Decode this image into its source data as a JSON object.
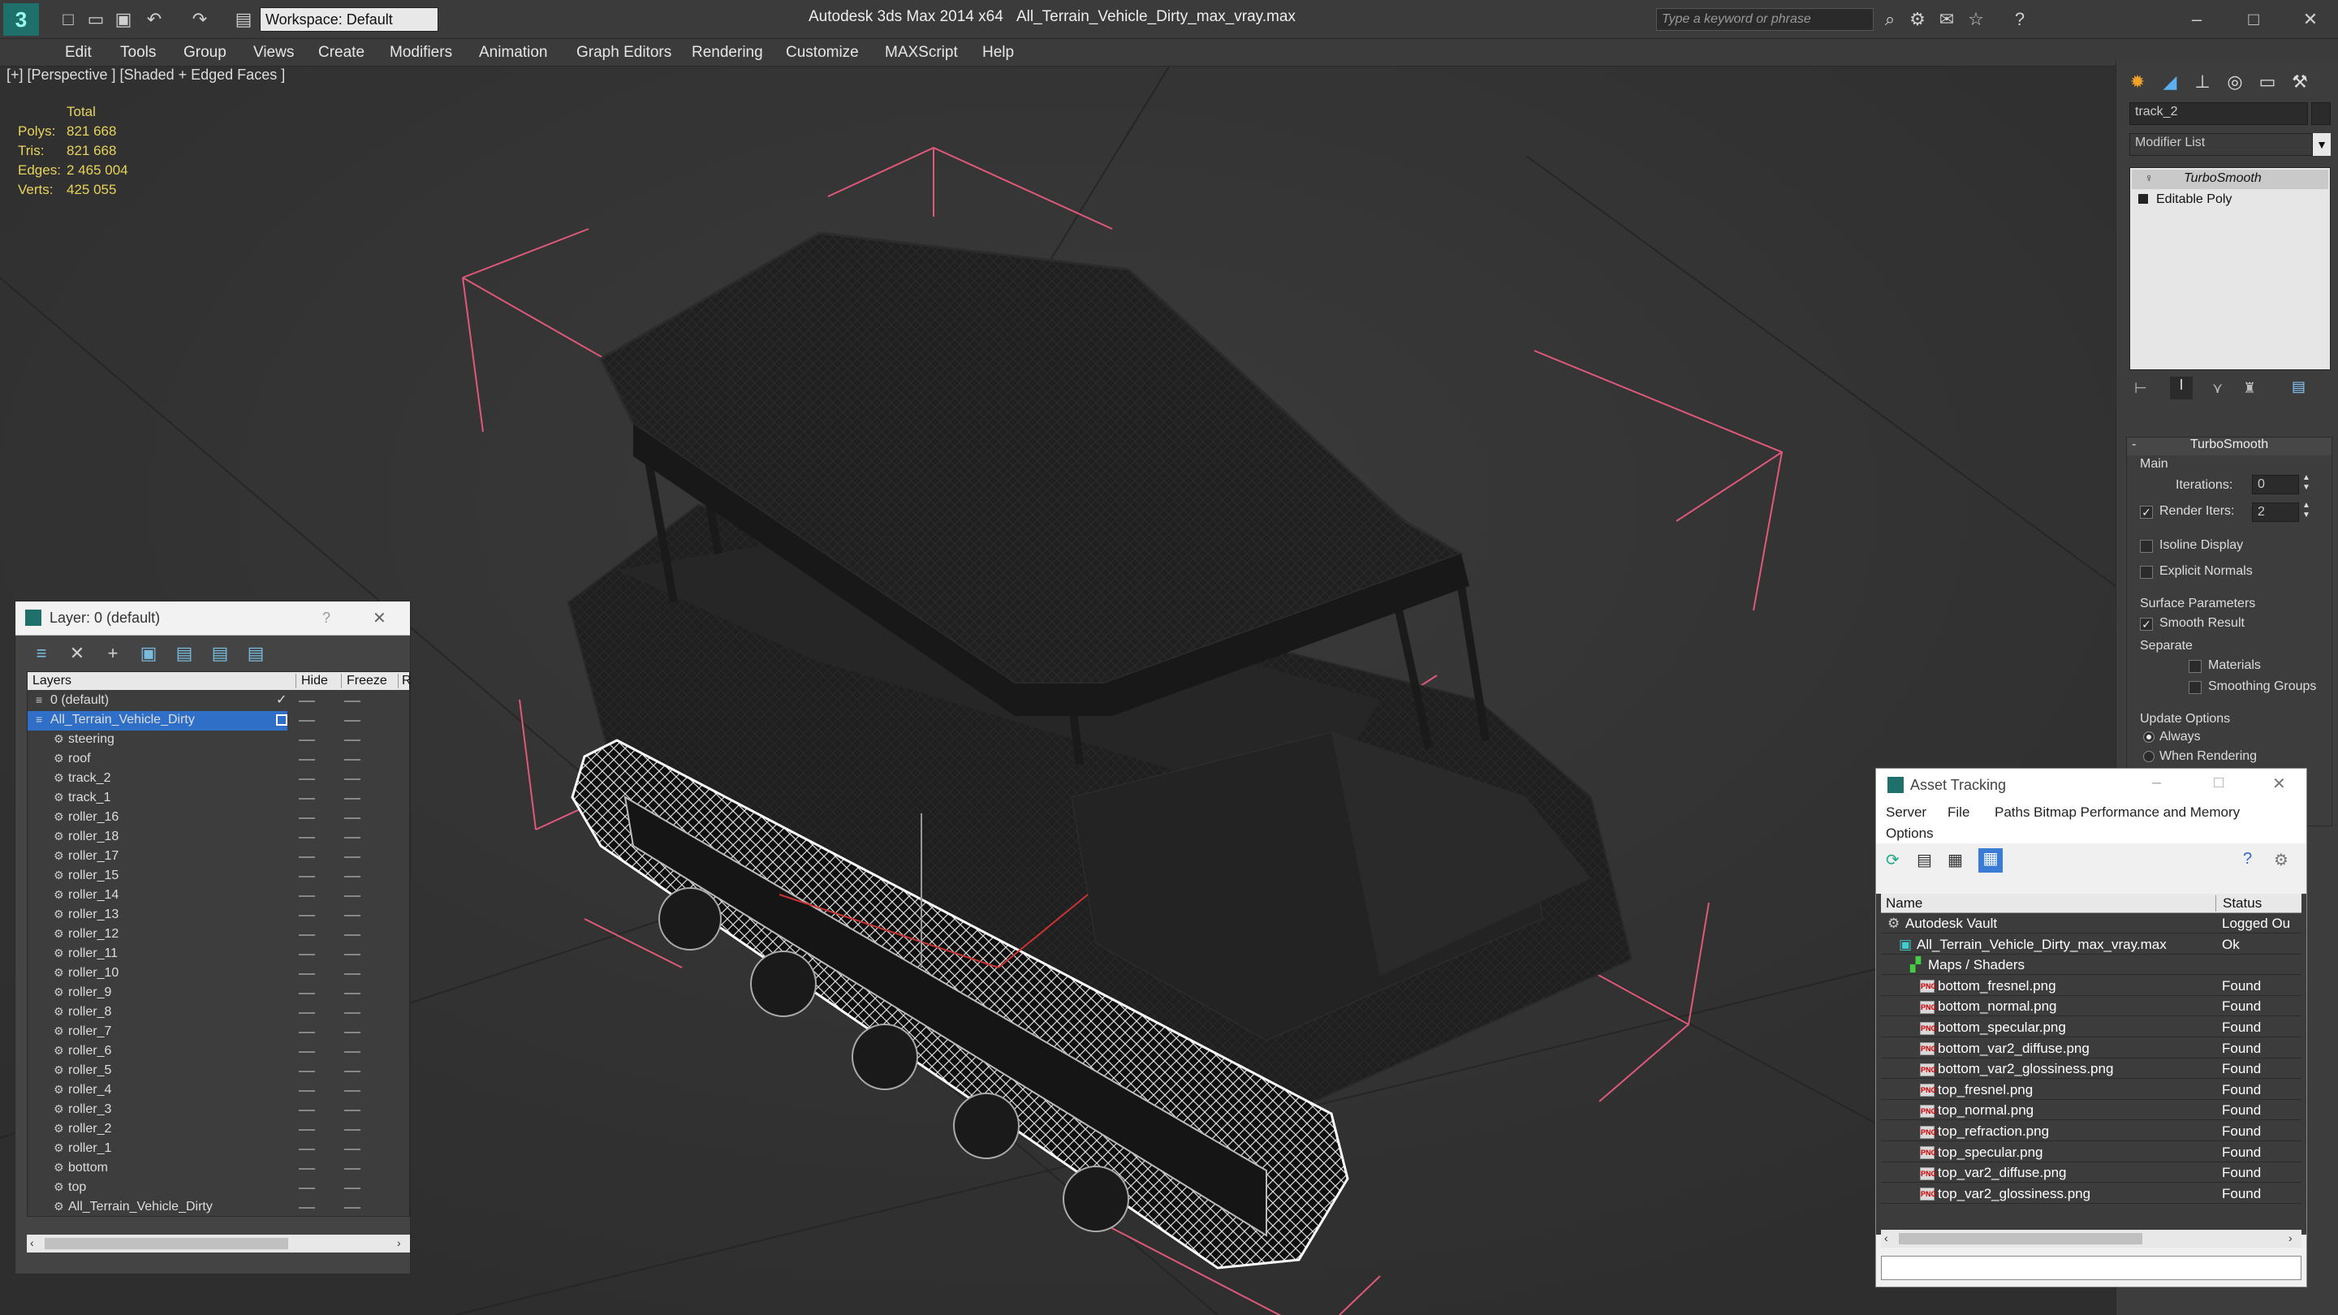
{
  "titlebar": {
    "workspace": "Workspace: Default",
    "title_app": "Autodesk 3ds Max  2014 x64",
    "title_file": "All_Terrain_Vehicle_Dirty_max_vray.max",
    "search_placeholder": "Type a keyword or phrase"
  },
  "menu": [
    "Edit",
    "Tools",
    "Group",
    "Views",
    "Create",
    "Modifiers",
    "Animation",
    "Graph Editors",
    "Rendering",
    "Customize",
    "MAXScript",
    "Help"
  ],
  "viewport": {
    "label": "[+] [Perspective ] [Shaded + Edged Faces ]",
    "stats_header": "Total",
    "stats": [
      {
        "label": "Polys:",
        "value": "821 668"
      },
      {
        "label": "Tris:",
        "value": "821 668"
      },
      {
        "label": "Edges:",
        "value": "2 465 004"
      },
      {
        "label": "Verts:",
        "value": "425 055"
      }
    ]
  },
  "command_panel": {
    "object_name": "track_2",
    "modifier_list": "Modifier List",
    "stack": [
      "TurboSmooth",
      "Editable Poly"
    ],
    "rollout_title": "TurboSmooth",
    "main_label": "Main",
    "iterations_label": "Iterations:",
    "iterations_value": "0",
    "render_iters_label": "Render Iters:",
    "render_iters_value": "2",
    "isoline": "Isoline Display",
    "explicit_normals": "Explicit Normals",
    "surface_params": "Surface Parameters",
    "smooth_result": "Smooth Result",
    "separate": "Separate",
    "materials": "Materials",
    "smoothing_groups": "Smoothing Groups",
    "update_options": "Update Options",
    "always": "Always",
    "when_rendering": "When Rendering"
  },
  "layer_window": {
    "title": "Layer: 0 (default)",
    "help": "?",
    "col_layers": "Layers",
    "col_hide": "Hide",
    "col_freeze": "Freeze",
    "col_r": "R",
    "rows": [
      "0 (default)",
      "All_Terrain_Vehicle_Dirty",
      "steering",
      "roof",
      "track_2",
      "track_1",
      "roller_16",
      "roller_18",
      "roller_17",
      "roller_15",
      "roller_14",
      "roller_13",
      "roller_12",
      "roller_11",
      "roller_10",
      "roller_9",
      "roller_8",
      "roller_7",
      "roller_6",
      "roller_5",
      "roller_4",
      "roller_3",
      "roller_2",
      "roller_1",
      "bottom",
      "top",
      "All_Terrain_Vehicle_Dirty"
    ]
  },
  "asset_tracking": {
    "title": "Asset Tracking",
    "menu": [
      "Server",
      "File",
      "Paths",
      "Bitmap Performance and Memory"
    ],
    "options": "Options",
    "col_name": "Name",
    "col_status": "Status",
    "rows": [
      {
        "name": "Autodesk Vault",
        "status": "Logged Ou"
      },
      {
        "name": "All_Terrain_Vehicle_Dirty_max_vray.max",
        "status": "Ok"
      },
      {
        "name": "Maps / Shaders",
        "status": ""
      },
      {
        "name": "bottom_fresnel.png",
        "status": "Found"
      },
      {
        "name": "bottom_normal.png",
        "status": "Found"
      },
      {
        "name": "bottom_specular.png",
        "status": "Found"
      },
      {
        "name": "bottom_var2_diffuse.png",
        "status": "Found"
      },
      {
        "name": "bottom_var2_glossiness.png",
        "status": "Found"
      },
      {
        "name": "top_fresnel.png",
        "status": "Found"
      },
      {
        "name": "top_normal.png",
        "status": "Found"
      },
      {
        "name": "top_refraction.png",
        "status": "Found"
      },
      {
        "name": "top_specular.png",
        "status": "Found"
      },
      {
        "name": "top_var2_diffuse.png",
        "status": "Found"
      },
      {
        "name": "top_var2_glossiness.png",
        "status": "Found"
      }
    ]
  }
}
